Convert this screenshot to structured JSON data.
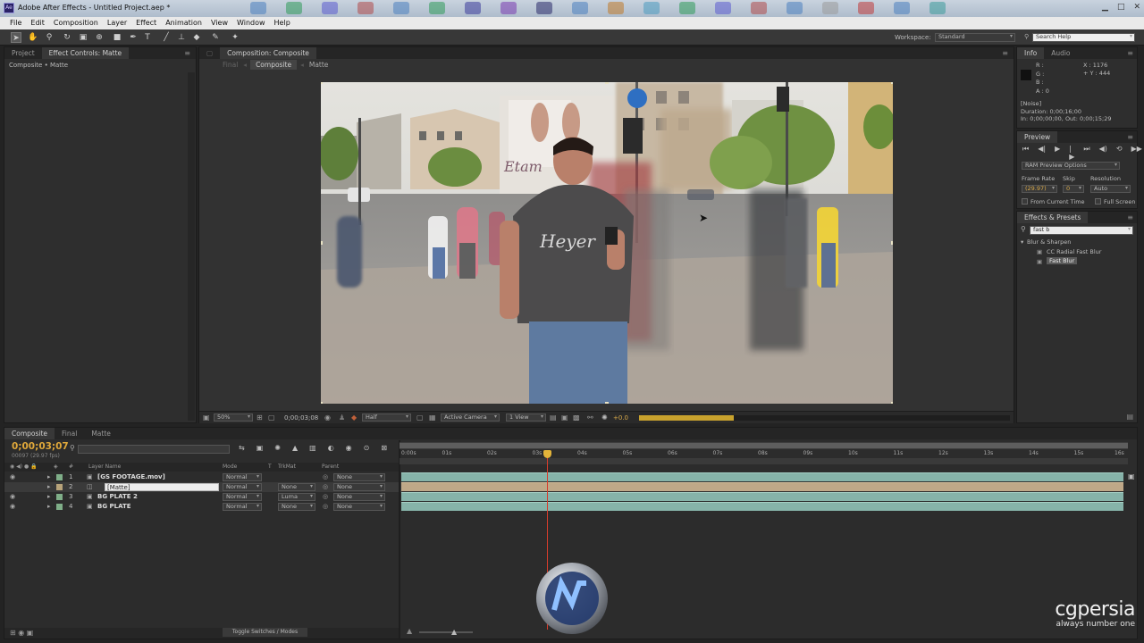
{
  "window": {
    "title": "Adobe After Effects - Untitled Project.aep *",
    "app_icon": "Ae"
  },
  "menu": [
    "File",
    "Edit",
    "Composition",
    "Layer",
    "Effect",
    "Animation",
    "View",
    "Window",
    "Help"
  ],
  "workspace": {
    "label": "Workspace:",
    "value": "Standard",
    "search_placeholder": "Search Help"
  },
  "left_panel": {
    "tabs": [
      "Project",
      "Effect Controls: Matte"
    ],
    "breadcrumb": "Composite • Matte"
  },
  "comp_panel": {
    "tab": "Composition: Composite",
    "crumbs": [
      "Final",
      "Composite",
      "Matte"
    ],
    "zoom": "50%",
    "timecode": "0;00;03;08",
    "resolution": "Half",
    "camera": "Active Camera",
    "views": "1 View",
    "exposure": "+0.0",
    "preview_progress": 0.255
  },
  "info": {
    "tabs": [
      "Info",
      "Audio"
    ],
    "channels": [
      "R :",
      "G :",
      "B :",
      "A : 0"
    ],
    "x": "X : 1176",
    "y": "+ Y : 444",
    "layer_name": "[Noise]",
    "duration": "Duration: 0;00;16;00",
    "inout": "In: 0;00;00;00, Out: 0;00;15;29"
  },
  "preview": {
    "title": "Preview",
    "ram_label": "RAM Preview Options",
    "frame_rate_label": "Frame Rate",
    "skip_label": "Skip",
    "resolution_label": "Resolution",
    "frame_rate": "(29.97)",
    "skip": "0",
    "resolution": "Auto",
    "from_current": "From Current Time",
    "full_screen": "Full Screen"
  },
  "effects": {
    "title": "Effects & Presets",
    "search": "fast b",
    "category": "Blur & Sharpen",
    "items": [
      "CC Radial Fast Blur",
      "Fast Blur"
    ]
  },
  "timeline": {
    "tabs": [
      "Composite",
      "Final",
      "Matte"
    ],
    "timecode": "0;00;03;07",
    "fps": "00097 (29.97 fps)",
    "columns": {
      "num": "#",
      "layer": "Layer Name",
      "mode": "Mode",
      "t": "T",
      "trkmat": "TrkMat",
      "parent": "Parent"
    },
    "layers": [
      {
        "num": "1",
        "name": "[GS FOOTAGE.mov]",
        "mode": "Normal",
        "trkmat": "",
        "parent": "None"
      },
      {
        "num": "2",
        "name": "[Matte]",
        "mode": "Normal",
        "trkmat": "None",
        "parent": "None"
      },
      {
        "num": "3",
        "name": "BG PLATE 2",
        "mode": "Normal",
        "trkmat": "Luma",
        "parent": "None"
      },
      {
        "num": "4",
        "name": "BG PLATE",
        "mode": "Normal",
        "trkmat": "None",
        "parent": "None"
      }
    ],
    "ruler": [
      "0:00s",
      "01s",
      "02s",
      "03s",
      "04s",
      "05s",
      "06s",
      "07s",
      "08s",
      "09s",
      "10s",
      "11s",
      "12s",
      "13s",
      "14s",
      "15s",
      "16s"
    ],
    "toggle_label": "Toggle Switches / Modes"
  },
  "watermark": {
    "brand": "cgpersia",
    "tagline": "always number one"
  }
}
